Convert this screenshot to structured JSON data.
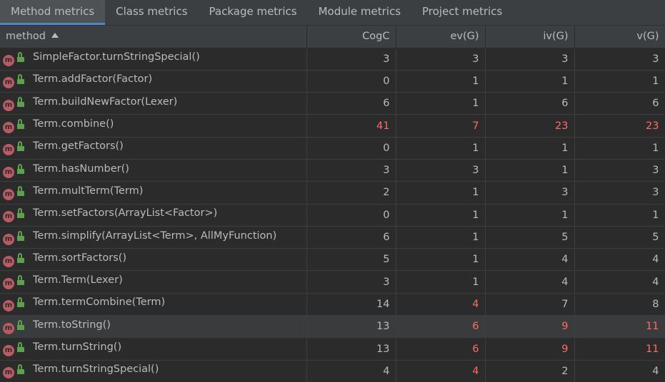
{
  "tabs": [
    {
      "label": "Method metrics",
      "active": true
    },
    {
      "label": "Class metrics",
      "active": false
    },
    {
      "label": "Package metrics",
      "active": false
    },
    {
      "label": "Module metrics",
      "active": false
    },
    {
      "label": "Project metrics",
      "active": false
    }
  ],
  "table": {
    "columns": [
      "method",
      "CogC",
      "ev(G)",
      "iv(G)",
      "v(G)"
    ],
    "sort_column": "method",
    "sort_direction": "ascending",
    "method_icon_letter": "m",
    "colors": {
      "highlight": "#ff6b68",
      "method_icon": "#b75c64",
      "lock_icon": "#5fa04e",
      "active_tab_underline": "#4a88c7"
    },
    "rows": [
      {
        "method": "SimpleFactor.turnStringSpecial()",
        "cogc": "3",
        "evg": "3",
        "ivg": "3",
        "vg": "3",
        "red": []
      },
      {
        "method": "Term.addFactor(Factor)",
        "cogc": "0",
        "evg": "1",
        "ivg": "1",
        "vg": "1",
        "red": []
      },
      {
        "method": "Term.buildNewFactor(Lexer)",
        "cogc": "6",
        "evg": "1",
        "ivg": "6",
        "vg": "6",
        "red": []
      },
      {
        "method": "Term.combine()",
        "cogc": "41",
        "evg": "7",
        "ivg": "23",
        "vg": "23",
        "red": [
          "cogc",
          "evg",
          "ivg",
          "vg"
        ]
      },
      {
        "method": "Term.getFactors()",
        "cogc": "0",
        "evg": "1",
        "ivg": "1",
        "vg": "1",
        "red": []
      },
      {
        "method": "Term.hasNumber()",
        "cogc": "3",
        "evg": "3",
        "ivg": "1",
        "vg": "3",
        "red": []
      },
      {
        "method": "Term.multTerm(Term)",
        "cogc": "2",
        "evg": "1",
        "ivg": "3",
        "vg": "3",
        "red": []
      },
      {
        "method": "Term.setFactors(ArrayList<Factor>)",
        "cogc": "0",
        "evg": "1",
        "ivg": "1",
        "vg": "1",
        "red": []
      },
      {
        "method": "Term.simplify(ArrayList<Term>, AllMyFunction)",
        "cogc": "6",
        "evg": "1",
        "ivg": "5",
        "vg": "5",
        "red": []
      },
      {
        "method": "Term.sortFactors()",
        "cogc": "5",
        "evg": "1",
        "ivg": "4",
        "vg": "4",
        "red": []
      },
      {
        "method": "Term.Term(Lexer)",
        "cogc": "3",
        "evg": "1",
        "ivg": "4",
        "vg": "4",
        "red": []
      },
      {
        "method": "Term.termCombine(Term)",
        "cogc": "14",
        "evg": "4",
        "ivg": "7",
        "vg": "8",
        "red": [
          "evg"
        ]
      },
      {
        "method": "Term.toString()",
        "cogc": "13",
        "evg": "6",
        "ivg": "9",
        "vg": "11",
        "red": [
          "evg",
          "ivg",
          "vg"
        ],
        "selected": true
      },
      {
        "method": "Term.turnString()",
        "cogc": "13",
        "evg": "6",
        "ivg": "9",
        "vg": "11",
        "red": [
          "evg",
          "ivg",
          "vg"
        ]
      },
      {
        "method": "Term.turnStringSpecial()",
        "cogc": "4",
        "evg": "4",
        "ivg": "2",
        "vg": "4",
        "red": [
          "evg"
        ]
      }
    ]
  }
}
